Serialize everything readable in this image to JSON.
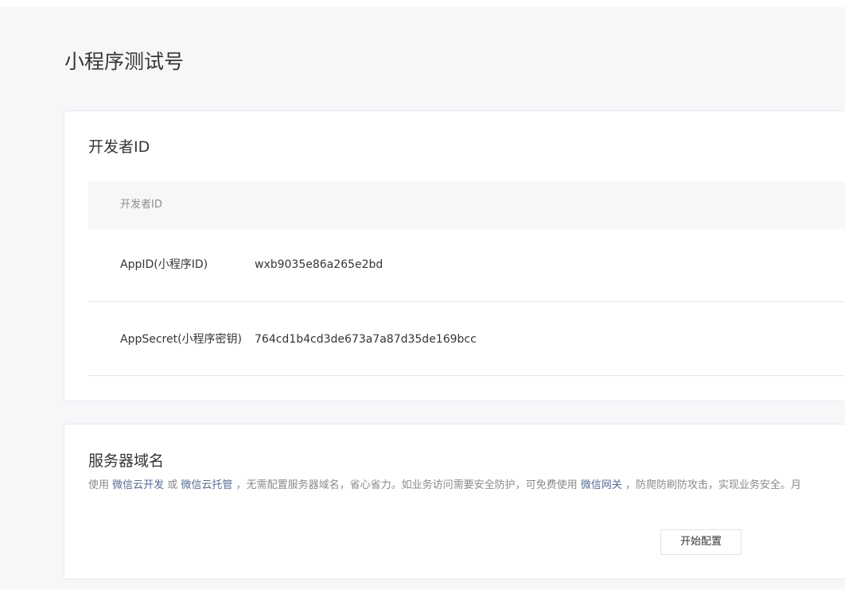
{
  "page": {
    "title": "小程序测试号"
  },
  "developer": {
    "section_title": "开发者ID",
    "table_header": "开发者ID",
    "rows": [
      {
        "label": "AppID(小程序ID)",
        "value": "wxb9035e86a265e2bd"
      },
      {
        "label": "AppSecret(小程序密钥)",
        "value": "764cd1b4cd3de673a7a87d35de169bcc"
      }
    ]
  },
  "server": {
    "section_title": "服务器域名",
    "desc": {
      "part1": "使用 ",
      "link1": "微信云开发",
      "part2": " 或 ",
      "link2": "微信云托管",
      "part3": " ，无需配置服务器域名，省心省力。如业务访问需要安全防护，可免费使用 ",
      "link3": "微信网关",
      "part4": " ，防爬防刷防攻击，实现业务安全。",
      "cut": "月"
    },
    "button_label": "开始配置"
  },
  "colors": {
    "page_bg": "#f6f7f9",
    "link": "#576b95",
    "text": "#353535",
    "muted": "#8c8c8c"
  }
}
